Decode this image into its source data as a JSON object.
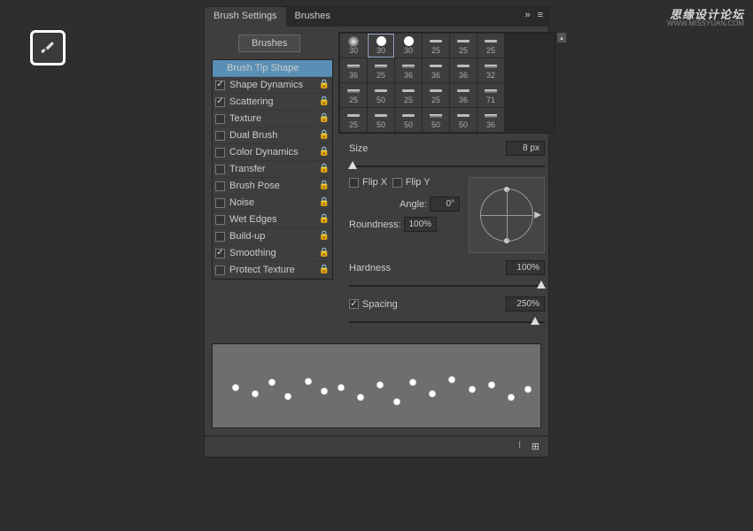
{
  "watermark": "思缘设计论坛",
  "watermark_url": "WWW.MISSYUAN.COM",
  "tabs": {
    "settings": "Brush Settings",
    "brushes": "Brushes"
  },
  "brushes_btn": "Brushes",
  "settings": [
    {
      "label": "Brush Tip Shape",
      "checked": null,
      "locked": false,
      "selected": true
    },
    {
      "label": "Shape Dynamics",
      "checked": true,
      "locked": true
    },
    {
      "label": "Scattering",
      "checked": true,
      "locked": true
    },
    {
      "label": "Texture",
      "checked": false,
      "locked": true
    },
    {
      "label": "Dual Brush",
      "checked": false,
      "locked": true
    },
    {
      "label": "Color Dynamics",
      "checked": false,
      "locked": true
    },
    {
      "label": "Transfer",
      "checked": false,
      "locked": true
    },
    {
      "label": "Brush Pose",
      "checked": false,
      "locked": true
    },
    {
      "label": "Noise",
      "checked": false,
      "locked": true
    },
    {
      "label": "Wet Edges",
      "checked": false,
      "locked": true
    },
    {
      "label": "Build-up",
      "checked": false,
      "locked": true
    },
    {
      "label": "Smoothing",
      "checked": true,
      "locked": true
    },
    {
      "label": "Protect Texture",
      "checked": false,
      "locked": true
    }
  ],
  "presets": [
    [
      {
        "t": "soft",
        "n": "30"
      },
      {
        "t": "hard",
        "n": "30",
        "sel": true
      },
      {
        "t": "hard",
        "n": "30"
      },
      {
        "t": "line",
        "n": "25"
      },
      {
        "t": "line",
        "n": "25"
      },
      {
        "t": "line",
        "n": "25"
      }
    ],
    [
      {
        "t": "line2",
        "n": "36"
      },
      {
        "t": "line2",
        "n": "25"
      },
      {
        "t": "line2",
        "n": "36"
      },
      {
        "t": "line",
        "n": "36"
      },
      {
        "t": "line",
        "n": "36"
      },
      {
        "t": "line2",
        "n": "32"
      }
    ],
    [
      {
        "t": "line2",
        "n": "25"
      },
      {
        "t": "line",
        "n": "50"
      },
      {
        "t": "line",
        "n": "25"
      },
      {
        "t": "line",
        "n": "25"
      },
      {
        "t": "line",
        "n": "36"
      },
      {
        "t": "line2",
        "n": "71"
      }
    ],
    [
      {
        "t": "line",
        "n": "25"
      },
      {
        "t": "line",
        "n": "50"
      },
      {
        "t": "line",
        "n": "50"
      },
      {
        "t": "line2",
        "n": "50"
      },
      {
        "t": "line",
        "n": "50"
      },
      {
        "t": "line2",
        "n": "36"
      }
    ]
  ],
  "size_lbl": "Size",
  "size_val": "8 px",
  "flipx": "Flip X",
  "flipy": "Flip Y",
  "angle_lbl": "Angle:",
  "angle_val": "0°",
  "round_lbl": "Roundness:",
  "round_val": "100%",
  "hard_lbl": "Hardness",
  "hard_val": "100%",
  "spacing_lbl": "Spacing",
  "spacing_val": "250%",
  "collapse": "»"
}
